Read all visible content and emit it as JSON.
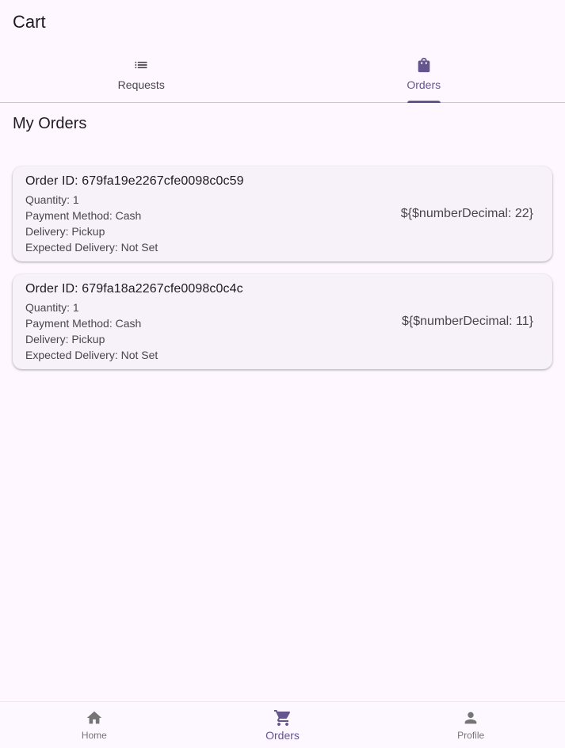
{
  "app_bar": {
    "title": "Cart"
  },
  "tabs": [
    {
      "label": "Requests",
      "icon": "list-icon",
      "active": false
    },
    {
      "label": "Orders",
      "icon": "shopping-bag-icon",
      "active": true
    }
  ],
  "section": {
    "title": "My Orders"
  },
  "orders": [
    {
      "id_text": "Order ID: 679fa19e2267cfe0098c0c59",
      "quantity": "Quantity: 1",
      "payment": "Payment Method: Cash",
      "delivery": "Delivery: Pickup",
      "expected": "Expected Delivery: Not Set",
      "price": "${$numberDecimal: 22}"
    },
    {
      "id_text": "Order ID: 679fa18a2267cfe0098c0c4c",
      "quantity": "Quantity: 1",
      "payment": "Payment Method: Cash",
      "delivery": "Delivery: Pickup",
      "expected": "Expected Delivery: Not Set",
      "price": "${$numberDecimal: 11}"
    }
  ],
  "bottom_nav": [
    {
      "label": "Home",
      "icon": "home-icon",
      "active": false
    },
    {
      "label": "Orders",
      "icon": "cart-icon",
      "active": true
    },
    {
      "label": "Profile",
      "icon": "person-icon",
      "active": false
    }
  ],
  "colors": {
    "background": "#fef7ff",
    "accent": "#65558f",
    "card": "#f7f2fa",
    "text": "#1d1b20",
    "muted": "#49454f"
  }
}
